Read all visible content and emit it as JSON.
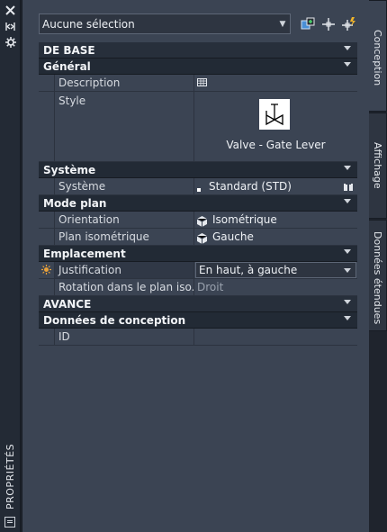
{
  "window": {
    "title": "PROPRIÉTÉS",
    "icons": [
      "close-icon",
      "auto-hide-icon",
      "settings-icon",
      "properties-icon"
    ]
  },
  "toolbar": {
    "selection_value": "Aucune sélection",
    "buttons": [
      "toggle-pickadd-icon",
      "select-objects-icon",
      "quick-select-icon"
    ]
  },
  "sections": {
    "de_base": "DE BASE",
    "general": "Général",
    "systeme": "Système",
    "mode_plan": "Mode plan",
    "emplacement": "Emplacement",
    "avance": "AVANCE",
    "donnees_conception": "Données de conception"
  },
  "props": {
    "description_label": "Description",
    "style_label": "Style",
    "style_value": "Valve - Gate Lever",
    "systeme_label": "Système",
    "systeme_value": "Standard (STD)",
    "orientation_label": "Orientation",
    "orientation_value": "Isométrique",
    "plan_iso_label": "Plan isométrique",
    "plan_iso_value": "Gauche",
    "justification_label": "Justification",
    "justification_value": "En haut, à gauche",
    "rotation_label": "Rotation dans le plan iso...",
    "rotation_value": "Droit",
    "id_label": "ID",
    "id_value": ""
  },
  "tabs": [
    {
      "label": "Conception",
      "active": true
    },
    {
      "label": "Affichage",
      "active": false
    },
    {
      "label": "Données étendues",
      "active": false
    }
  ],
  "colors": {
    "palette_bg": "#3b4453",
    "section_bg": "#222a35",
    "strip_bg": "#232a35",
    "accent_star": "#e8a13a"
  }
}
